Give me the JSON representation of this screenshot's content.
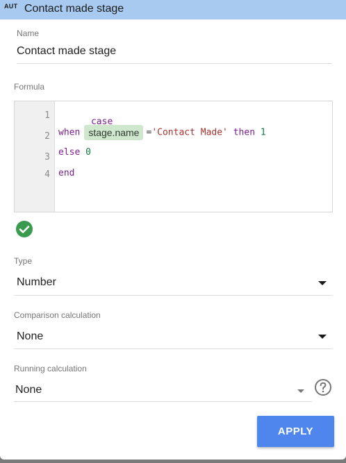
{
  "header": {
    "badge": "AUT",
    "title": "Contact made stage"
  },
  "name_field": {
    "label": "Name",
    "value": "Contact made stage"
  },
  "formula": {
    "label": "Formula",
    "line_numbers": [
      "1",
      "2",
      "3",
      "4"
    ],
    "lines": {
      "l1_kw": "case",
      "l2_kw": "when",
      "l2_field": "stage.name",
      "l2_op": "=",
      "l2_str": "'Contact Made'",
      "l2_kw2": "then",
      "l2_num": "1",
      "l3_kw": "else",
      "l3_num": "0",
      "l4_kw": "end"
    },
    "status_icon": "check-circle-icon"
  },
  "type_field": {
    "label": "Type",
    "value": "Number"
  },
  "comparison_field": {
    "label": "Comparison calculation",
    "value": "None"
  },
  "running_field": {
    "label": "Running calculation",
    "value": "None",
    "help_icon": "question-circle-icon"
  },
  "apply_button": {
    "label": "APPLY"
  },
  "colors": {
    "header": "#a8c9f0",
    "accent": "#4f86ee",
    "valid": "#3a9a4e",
    "chip": "#cfe8cd"
  }
}
